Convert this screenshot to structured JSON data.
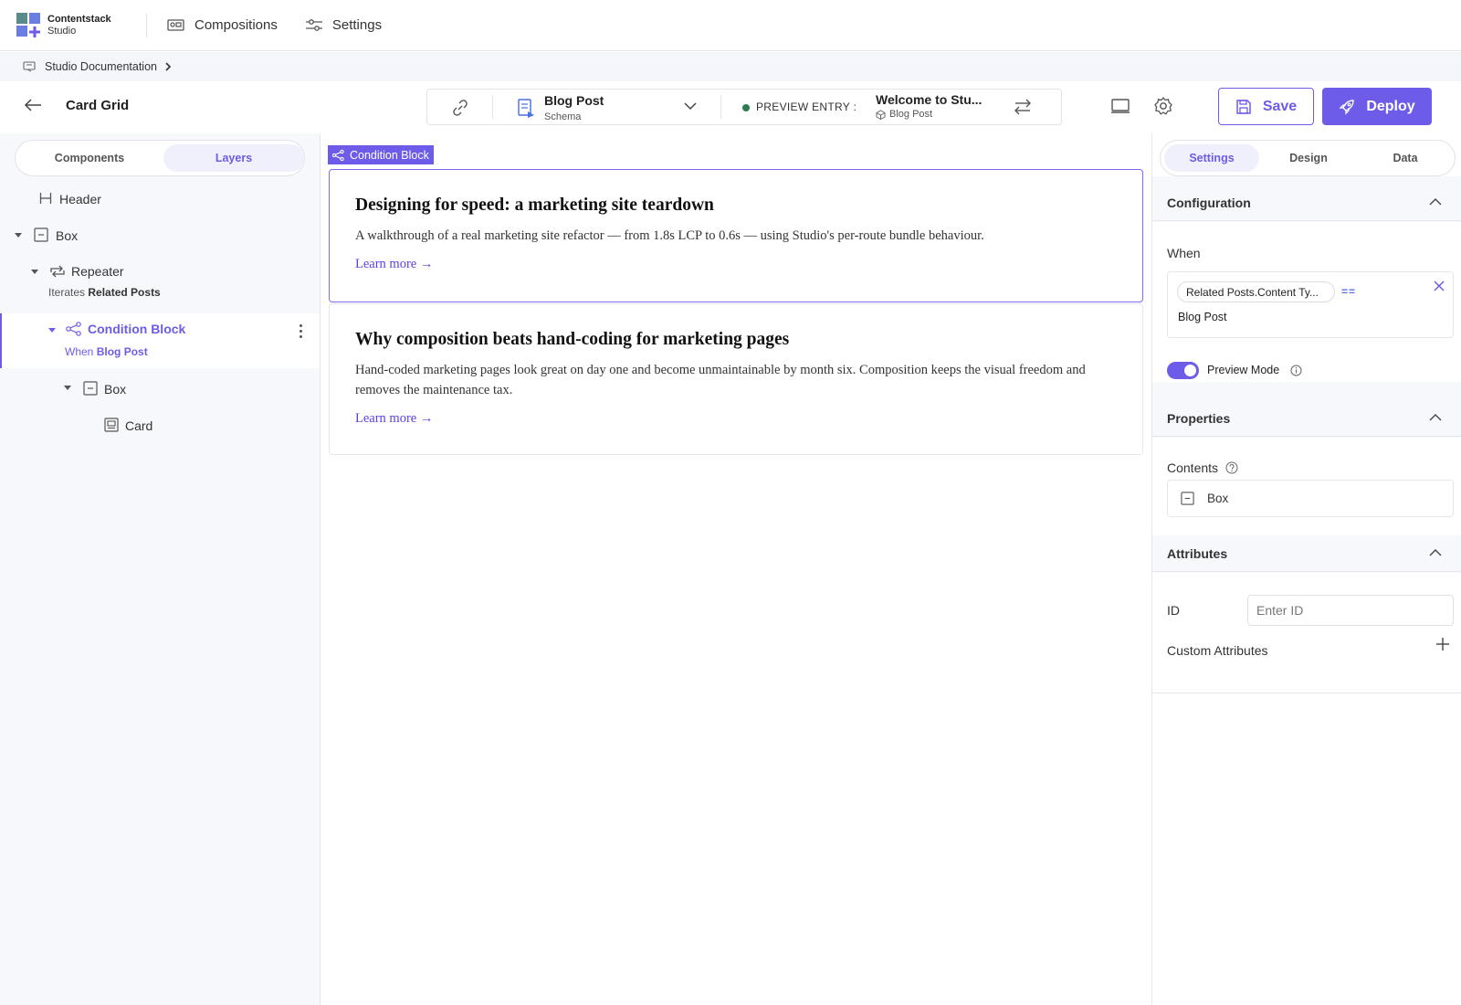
{
  "app": {
    "brand_line1": "Contentstack",
    "brand_line2": "Studio",
    "colors": {
      "accent": "#6c5ce7",
      "link": "#5b3fe0",
      "status_dot": "#2e7d4f"
    }
  },
  "topnav": {
    "items": [
      {
        "label": "Compositions",
        "icon": "compositions-icon"
      },
      {
        "label": "Settings",
        "icon": "sliders-icon"
      }
    ]
  },
  "breadcrumb": {
    "label": "Studio Documentation"
  },
  "toolbar": {
    "page_name": "Card Grid",
    "schema_title": "Blog Post",
    "schema_sub": "Schema",
    "preview_label": "PREVIEW ENTRY :",
    "preview_title": "Welcome to Stu...",
    "preview_sub": "Blog Post",
    "save_label": "Save",
    "deploy_label": "Deploy"
  },
  "left": {
    "tabs": [
      {
        "label": "Components"
      },
      {
        "label": "Layers",
        "active": true
      }
    ],
    "layers": [
      {
        "label": "Header"
      },
      {
        "label": "Box"
      },
      {
        "label": "Repeater",
        "sub_prefix": "Iterates",
        "sub_value": "Related Posts"
      },
      {
        "label": "Condition Block",
        "sub_prefix": "When",
        "sub_value": "Blog Post"
      },
      {
        "label": "Box"
      },
      {
        "label": "Card"
      }
    ]
  },
  "canvas": {
    "badge": "Condition Block",
    "cards": [
      {
        "title": "Designing for speed: a marketing site teardown",
        "body": "A walkthrough of a real marketing site refactor — from 1.8s LCP to 0.6s — using Studio's per-route bundle behaviour.",
        "link": "Learn more →"
      },
      {
        "title": "Why composition beats hand-coding for marketing pages",
        "body": "Hand-coded marketing pages look great on day one and become unmaintainable by month six. Composition keeps the visual freedom and removes the maintenance tax.",
        "link": "Learn more →"
      }
    ]
  },
  "right": {
    "tabs": [
      {
        "label": "Settings",
        "active": true
      },
      {
        "label": "Design"
      },
      {
        "label": "Data"
      }
    ],
    "configuration": {
      "title": "Configuration",
      "when_label": "When",
      "when_field": "Related Posts.Content Ty...",
      "when_op": "==",
      "when_value": "Blog Post",
      "preview_mode_label": "Preview Mode",
      "preview_mode_on": true
    },
    "properties": {
      "title": "Properties",
      "contents_label": "Contents",
      "contents_value": "Box"
    },
    "attributes": {
      "title": "Attributes",
      "id_label": "ID",
      "id_placeholder": "Enter ID",
      "custom_label": "Custom Attributes"
    }
  }
}
